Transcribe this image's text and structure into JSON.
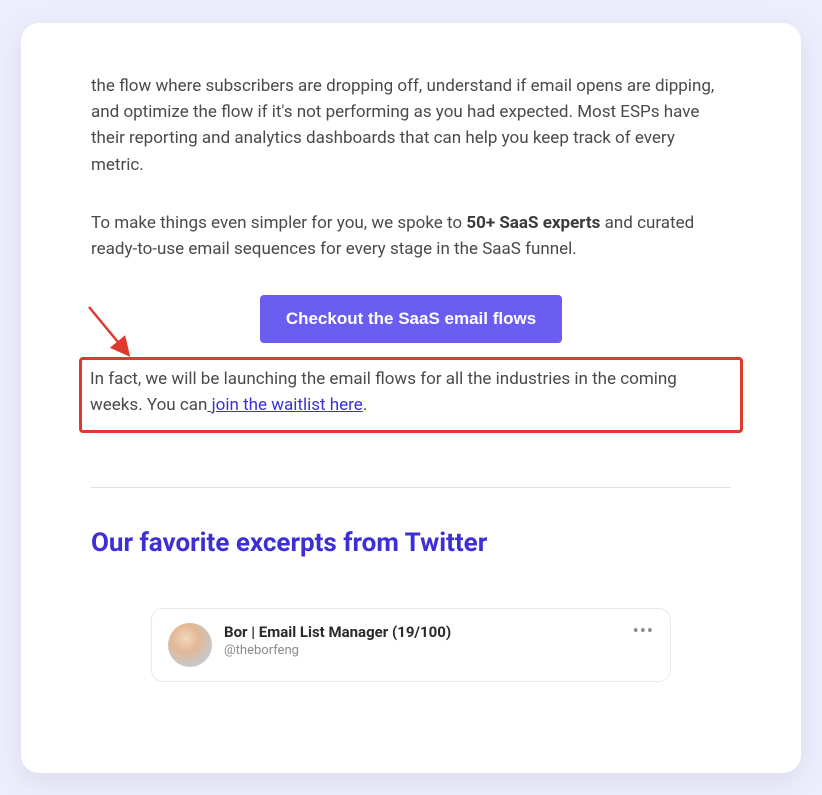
{
  "para1": "the flow where subscribers are dropping off, understand if email opens are dipping, and optimize the flow if it's not performing as you had expected. Most ESPs have their reporting and analytics dashboards that can help you keep track of every metric.",
  "para2_before": "To make things even simpler for you, we spoke to ",
  "para2_bold": "50+ SaaS experts",
  "para2_after": " and curated ready-to-use email sequences for every stage in the SaaS funnel.",
  "cta_label": "Checkout the SaaS email flows",
  "highlight_before": "In fact, we will be launching the email flows for all the industries in the coming weeks. You can",
  "highlight_link": " join the waitlist here",
  "highlight_after": ".",
  "section_title": "Our favorite excerpts from Twitter",
  "tweet": {
    "name": "Bor | Email List Manager (19/100)",
    "handle": "@theborfeng",
    "more": "•••"
  }
}
